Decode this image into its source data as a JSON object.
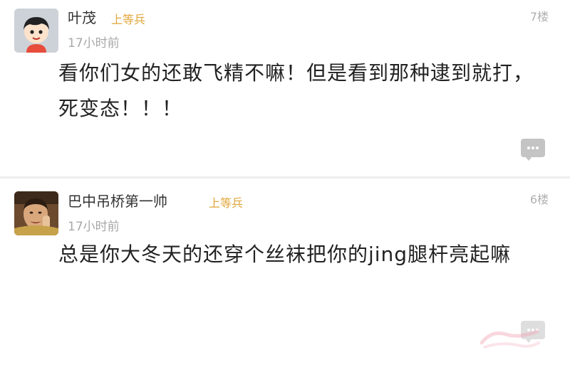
{
  "comments": [
    {
      "username": "叶茂",
      "rank": "上等兵",
      "time": "17小时前",
      "floor": "7楼",
      "content": "看你们女的还敢飞精不嘛！但是看到那种逮到就打，死变态！！！",
      "avatar_icon": "cartoon-kid-avatar"
    },
    {
      "username": "巴中吊桥第一帅",
      "rank": "上等兵",
      "time": "17小时前",
      "floor": "6楼",
      "content": "总是你大冬天的还穿个丝袜把你的jing腿杆亮起嘛",
      "avatar_icon": "photo-avatar"
    }
  ],
  "icons": {
    "reply": "comment-bubble-icon"
  },
  "colors": {
    "rank": "#e0a63a",
    "meta": "#a8a8a8",
    "text": "#222222",
    "divider": "#ededed"
  }
}
